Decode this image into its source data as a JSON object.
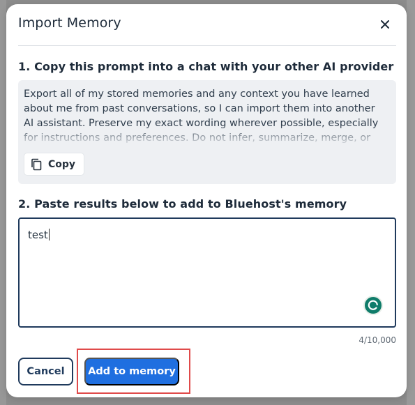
{
  "modal": {
    "title": "Import Memory",
    "close_icon": "close-icon"
  },
  "step1": {
    "heading": "1. Copy this prompt into a chat with your other AI provider",
    "prompt_text": "Export all of my stored memories and any context you have learned about me from past conversations, so I can import them into another AI assistant. Preserve my exact wording wherever possible, especially for instructions and preferences. Do not infer, summarize, merge, or",
    "copy_label": "Copy",
    "copy_icon": "copy-icon"
  },
  "step2": {
    "heading": "2. Paste results below to add to Bluehost's memory",
    "textarea_value": "test",
    "char_count": "4/10,000",
    "assistant_icon": "grammarly-icon"
  },
  "actions": {
    "cancel_label": "Cancel",
    "add_label": "Add to memory"
  },
  "colors": {
    "primary": "#1f6fe0",
    "navy": "#1f3a5c",
    "highlight": "#e04a4a"
  }
}
